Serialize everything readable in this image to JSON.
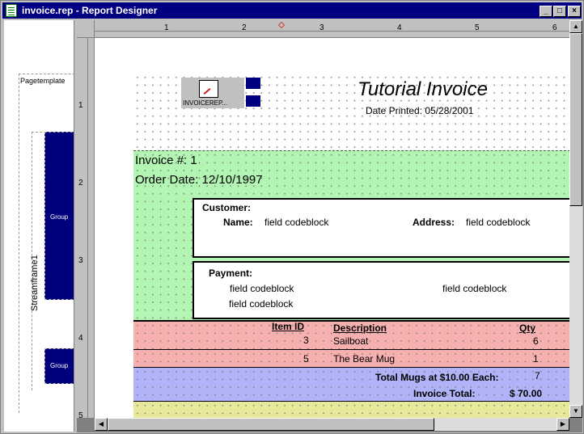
{
  "window": {
    "title": "invoice.rep - Report Designer",
    "buttons": {
      "minimize": "_",
      "maximize": "□",
      "close": "×"
    }
  },
  "left_panel": {
    "page_template_label": "Pagetemplate",
    "streamframe_label": "Streamframe1",
    "group_labels": [
      "Group",
      "Group"
    ]
  },
  "ruler": {
    "top_numbers": [
      "1",
      "2",
      "3",
      "4",
      "5",
      "6"
    ],
    "left_numbers": [
      "1",
      "2",
      "3",
      "4",
      "5"
    ]
  },
  "header": {
    "logo_caption": "INVOICEREP...",
    "title": "Tutorial Invoice",
    "date_printed": "Date Printed: 05/28/2001"
  },
  "invoice_band": {
    "invoice_no": "Invoice #: 1",
    "order_date": "Order Date: 12/10/1997",
    "customer": {
      "heading": "Customer:",
      "name_label": "Name:",
      "name_value": "field codeblock",
      "address_label": "Address:",
      "address_value": "field codeblock"
    },
    "payment": {
      "heading": "Payment:",
      "field1": "field codeblock",
      "field2": "field codeblock",
      "field3": "field codeblock"
    }
  },
  "items_band": {
    "headers": {
      "item_id": "Item ID",
      "description": "Description",
      "qty": "Qty"
    },
    "rows": [
      {
        "item_id": "3",
        "description": "Sailboat",
        "qty": "6"
      },
      {
        "item_id": "5",
        "description": "The Bear Mug",
        "qty": "1"
      }
    ]
  },
  "totals_band": {
    "mugs_label": "Total Mugs at $10.00 Each:",
    "mugs_value": "7",
    "total_label": "Invoice Total:",
    "total_value": "$ 70.00"
  },
  "colors": {
    "title_bar": "#000080",
    "invoice_band": "#b3f5b3",
    "items_band": "#f7b0b0",
    "totals_band": "#b0b3f7",
    "footer_band": "#e8e89a",
    "group_box": "#00007a"
  }
}
